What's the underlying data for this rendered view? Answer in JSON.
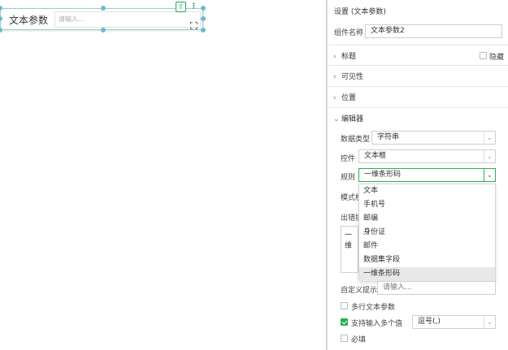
{
  "widget": {
    "label": "文本参数",
    "input_placeholder": "请输入...",
    "icons": {
      "export": "export-icon",
      "more": "more-vertical-icon",
      "fullscreen": "fullscreen-icon"
    }
  },
  "panel": {
    "title": "设置 (文本参数)",
    "component_name_label": "组件名称",
    "component_name_value": "文本参数2",
    "sections": {
      "title": "标题",
      "hide_label": "隐藏",
      "visibility": "可见性",
      "position": "位置",
      "editor": "编辑器"
    },
    "editor": {
      "data_type_label": "数据类型",
      "data_type_value": "字符串",
      "control_label": "控件",
      "control_value": "文本框",
      "rule_label": "规则",
      "rule_value": "一维条形码",
      "mode_label_partial": "模式校",
      "error_label_partial": "出错提",
      "textarea_partial": "一维",
      "custom_hint_label": "自定义提示",
      "custom_hint_placeholder": "请输入...",
      "multiline_label": "多行文本参数",
      "multi_value_label": "支持输入多个值",
      "separator_value": "逗号(,)",
      "required_label": "必填"
    },
    "rule_options": [
      "文本",
      "手机号",
      "邮编",
      "身份证",
      "邮件",
      "数据集字段",
      "一维条形码"
    ],
    "rule_selected_index": 6
  },
  "colors": {
    "accent_green": "#2cae53",
    "selection_teal": "#6bbcc9"
  }
}
